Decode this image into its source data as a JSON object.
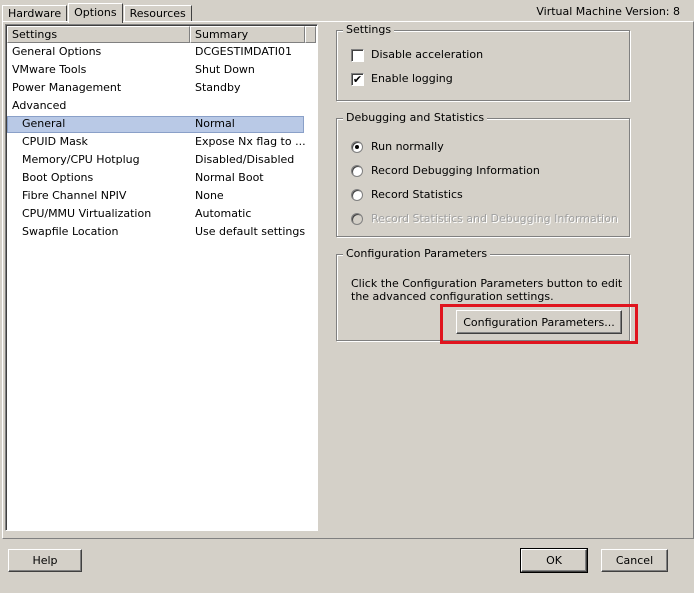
{
  "tabs": [
    {
      "label": "Hardware"
    },
    {
      "label": "Options"
    },
    {
      "label": "Resources"
    }
  ],
  "vm_version": "Virtual Machine Version: 8",
  "settings_list": {
    "headers": [
      "Settings",
      "Summary"
    ],
    "rows": [
      {
        "setting": "General Options",
        "summary": "DCGESTIMDATI01"
      },
      {
        "setting": "VMware Tools",
        "summary": "Shut Down"
      },
      {
        "setting": "Power Management",
        "summary": "Standby"
      },
      {
        "setting": "Advanced",
        "summary": ""
      },
      {
        "setting": "General",
        "summary": "Normal"
      },
      {
        "setting": "CPUID Mask",
        "summary": "Expose Nx flag to ..."
      },
      {
        "setting": "Memory/CPU Hotplug",
        "summary": "Disabled/Disabled"
      },
      {
        "setting": "Boot Options",
        "summary": "Normal Boot"
      },
      {
        "setting": "Fibre Channel NPIV",
        "summary": "None"
      },
      {
        "setting": "CPU/MMU Virtualization",
        "summary": "Automatic"
      },
      {
        "setting": "Swapfile Location",
        "summary": "Use default settings"
      }
    ]
  },
  "settings_group": {
    "title": "Settings",
    "disable_acceleration": "Disable acceleration",
    "enable_logging": "Enable logging",
    "disable_acceleration_checked": false,
    "enable_logging_checked": true
  },
  "debugging_group": {
    "title": "Debugging and Statistics",
    "options": [
      {
        "label": "Run normally",
        "selected": true,
        "enabled": true
      },
      {
        "label": "Record Debugging Information",
        "selected": false,
        "enabled": true
      },
      {
        "label": "Record Statistics",
        "selected": false,
        "enabled": true
      },
      {
        "label": "Record Statistics and Debugging Information",
        "selected": false,
        "enabled": false
      }
    ]
  },
  "config_group": {
    "title": "Configuration Parameters",
    "description": "Click the Configuration Parameters button to edit the advanced configuration settings.",
    "button_label": "Configuration Parameters..."
  },
  "footer": {
    "help": "Help",
    "ok": "OK",
    "cancel": "Cancel"
  },
  "colors": {
    "highlight": "#e0141e",
    "selection": "#b9c9e6"
  }
}
